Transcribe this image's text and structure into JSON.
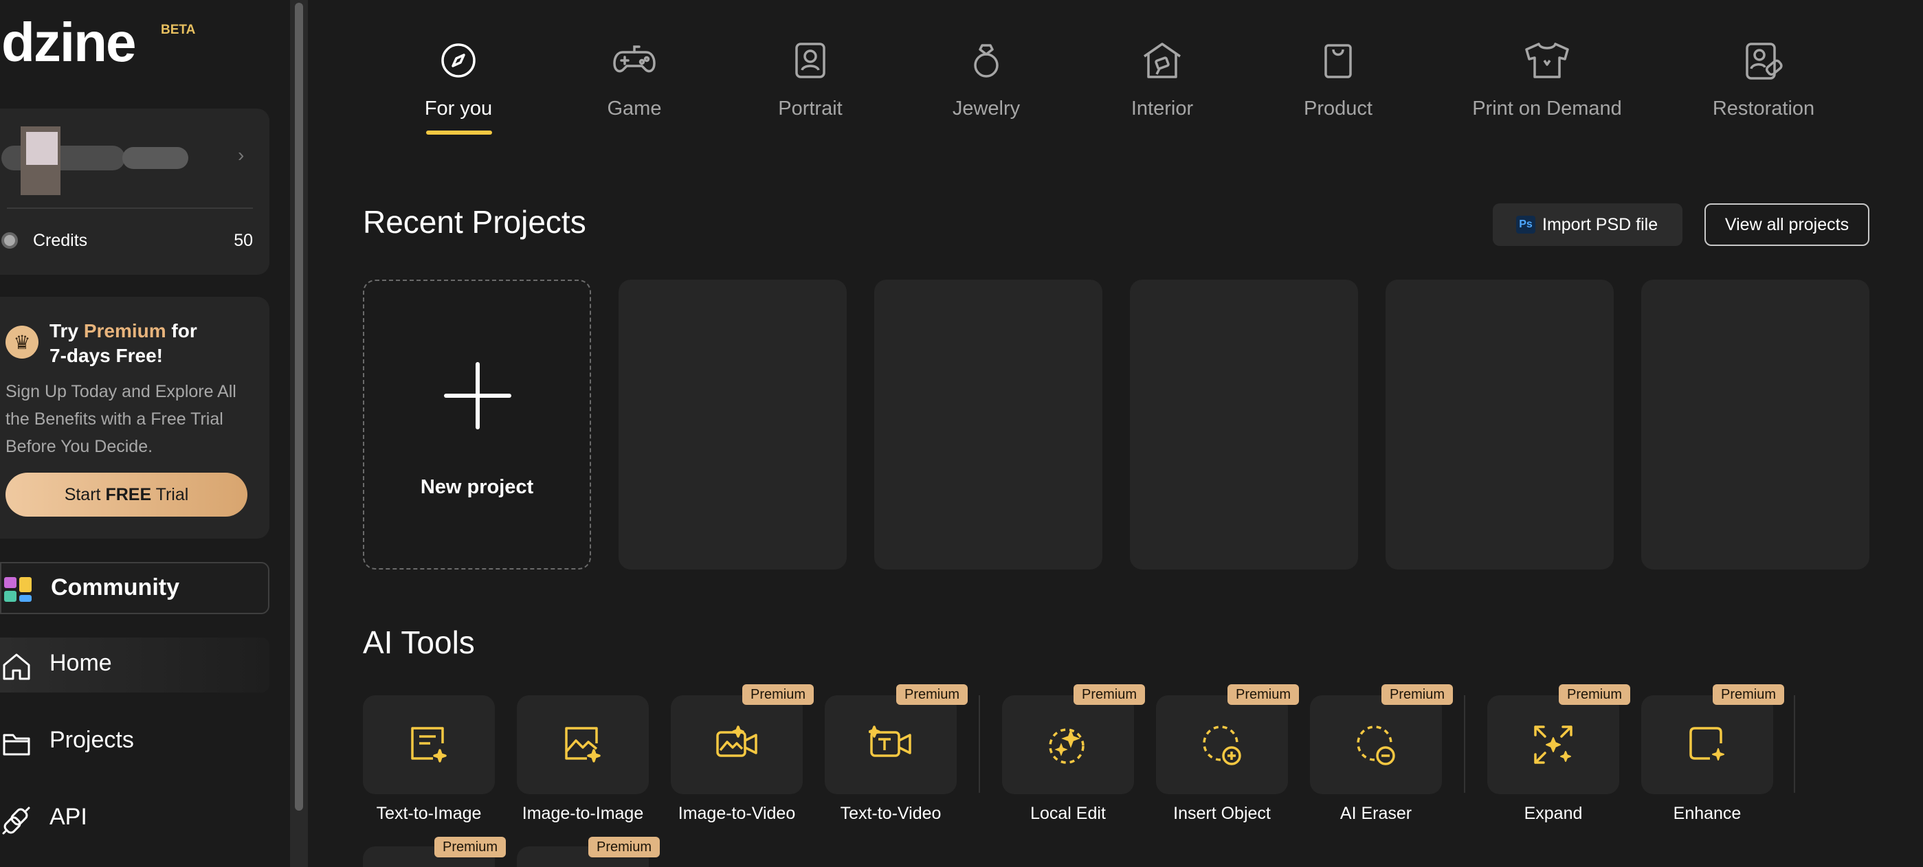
{
  "brand": {
    "logo": "dzine",
    "beta": "BETA"
  },
  "user": {
    "credits_label": "Credits",
    "credits_value": "50"
  },
  "promo": {
    "title_prefix": "Try ",
    "title_highlight": "Premium",
    "title_suffix": " for",
    "title_line2": "7-days Free!",
    "description": "Sign Up Today and Explore All the Benefits with a Free Trial Before You Decide.",
    "cta_prefix": "Start ",
    "cta_bold": "FREE",
    "cta_suffix": " Trial"
  },
  "sidebar": {
    "community": "Community",
    "home": "Home",
    "projects": "Projects",
    "api": "API"
  },
  "categories": [
    {
      "label": "For you",
      "icon": "compass-icon",
      "active": true
    },
    {
      "label": "Game",
      "icon": "gamepad-icon"
    },
    {
      "label": "Portrait",
      "icon": "portrait-icon"
    },
    {
      "label": "Jewelry",
      "icon": "ring-icon"
    },
    {
      "label": "Interior",
      "icon": "house-icon"
    },
    {
      "label": "Product",
      "icon": "bag-icon"
    },
    {
      "label": "Print on Demand",
      "icon": "tshirt-icon"
    },
    {
      "label": "Restoration",
      "icon": "restore-icon"
    }
  ],
  "recent": {
    "title": "Recent Projects",
    "import_label": "Import PSD file",
    "ps_badge": "Ps",
    "view_all": "View all projects",
    "new_project": "New project"
  },
  "ai_tools": {
    "title": "AI Tools",
    "premium_label": "Premium",
    "items": [
      {
        "label": "Text-to-Image",
        "icon": "text-to-image-icon",
        "premium": false
      },
      {
        "label": "Image-to-Image",
        "icon": "image-to-image-icon",
        "premium": false
      },
      {
        "label": "Image-to-Video",
        "icon": "image-to-video-icon",
        "premium": true
      },
      {
        "label": "Text-to-Video",
        "icon": "text-to-video-icon",
        "premium": true
      },
      {
        "label": "Local Edit",
        "icon": "local-edit-icon",
        "premium": true
      },
      {
        "label": "Insert Object",
        "icon": "insert-object-icon",
        "premium": true
      },
      {
        "label": "AI Eraser",
        "icon": "ai-eraser-icon",
        "premium": true
      },
      {
        "label": "Expand",
        "icon": "expand-icon",
        "premium": true
      },
      {
        "label": "Enhance",
        "icon": "enhance-icon",
        "premium": true
      }
    ]
  },
  "colors": {
    "accent": "#f5c842",
    "premium": "#e1b582",
    "background": "#1b1b1b",
    "card": "#262626"
  }
}
